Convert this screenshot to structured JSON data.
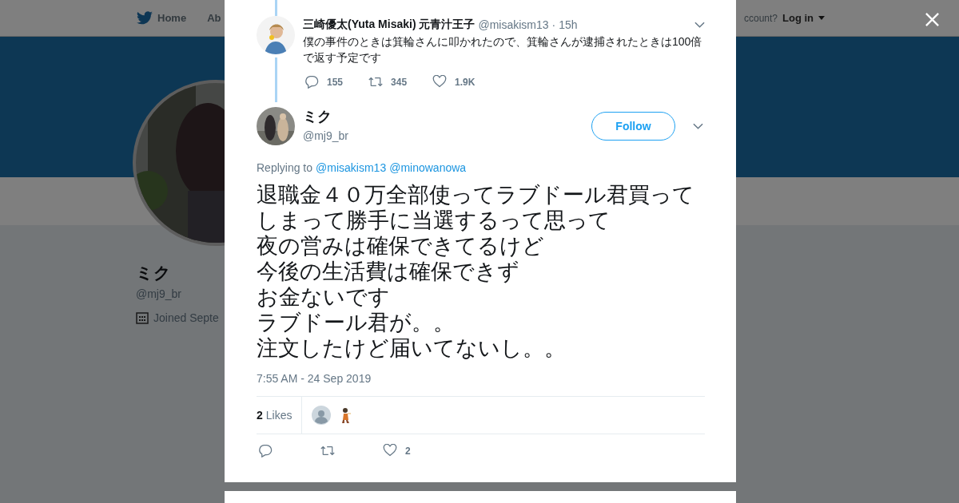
{
  "nav": {
    "home": "Home",
    "about": "Ab",
    "account_prompt": "ccount?",
    "login": "Log in"
  },
  "profile": {
    "name": "ミク",
    "handle": "@mj9_br",
    "joined": "Joined Septe"
  },
  "parent_tweet": {
    "author": "三崎優太(Yuta Misaki) 元青汁王子",
    "handle": "@misakism13",
    "time": "· 15h",
    "text": "僕の事件のときは箕輪さんに叩かれたので、箕輪さんが逮捕されたときは100倍で返す予定です",
    "replies": "155",
    "retweets": "345",
    "likes": "1.9K"
  },
  "tweet": {
    "author": "ミク",
    "handle": "@mj9_br",
    "follow": "Follow",
    "replying_label": "Replying to",
    "mentions": [
      "@misakism13",
      "@minowanowa"
    ],
    "text_lines": [
      "退職金４０万全部使ってラブドール君買ってしまって勝手に当選するって思って",
      "夜の営みは確保できてるけど",
      "今後の生活費は確保できず",
      "お金ないです",
      "ラブドール君が。。",
      "注文したけど届いてないし。。"
    ],
    "timestamp": "7:55 AM - 24 Sep 2019",
    "like_count": "2",
    "likes_label": "Likes",
    "likers": [
      {
        "kind": "default"
      },
      {
        "kind": "picture"
      }
    ],
    "action_likes": "2"
  }
}
